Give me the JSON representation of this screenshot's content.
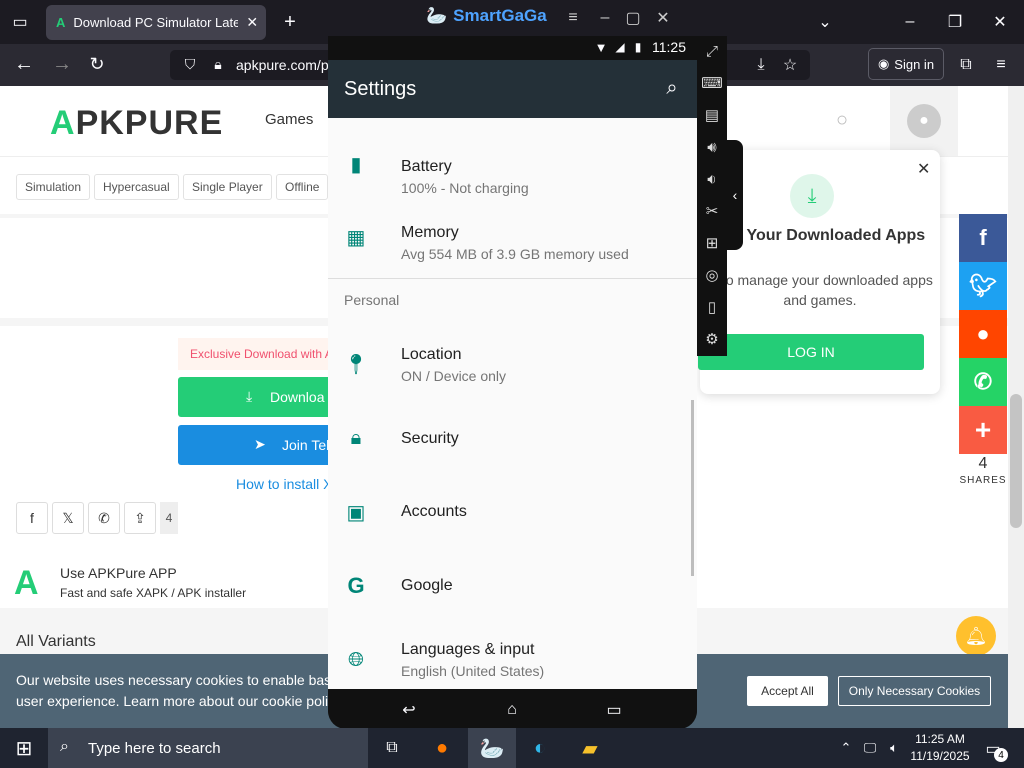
{
  "browser": {
    "tab_title": "Download PC Simulator Latest V",
    "url": "apkpure.com/p",
    "signin": "Sign in"
  },
  "smartgaga": {
    "title": "SmartGaGa"
  },
  "site": {
    "logo_a": "A",
    "logo_rest": "PKPURE",
    "nav_games": "Games",
    "chips": [
      "Simulation",
      "Hypercasual",
      "Single Player",
      "Offline"
    ],
    "exclusive": "Exclusive Download with A",
    "download": "Downloa",
    "join": "Join Tel",
    "howto": "How to install X",
    "share_count": "4",
    "app_title": "Use APKPure APP",
    "app_sub": "Fast and safe XAPK / APK installer",
    "variants": "All Variants",
    "popup": {
      "title": "age Your Downloaded Apps",
      "sub": "in to manage your downloaded apps and games.",
      "login": "LOG IN"
    },
    "shares_num": "4",
    "shares_label": "SHARES",
    "cookie": {
      "text": "Our website uses necessary cookies to enable bas user experience. Learn more about our cookie poli",
      "accept": "Accept All",
      "necessary": "Only Necessary Cookies"
    }
  },
  "android": {
    "time": "11:25",
    "title": "Settings",
    "items": [
      {
        "title": "Battery",
        "sub": "100% - Not charging"
      },
      {
        "title": "Memory",
        "sub": "Avg 554 MB of 3.9 GB memory used"
      },
      {
        "title": "Location",
        "sub": "ON / Device only"
      },
      {
        "title": "Security",
        "sub": ""
      },
      {
        "title": "Accounts",
        "sub": ""
      },
      {
        "title": "Google",
        "sub": ""
      },
      {
        "title": "Languages & input",
        "sub": "English (United States)"
      }
    ],
    "section": "Personal"
  },
  "taskbar": {
    "search": "Type here to search",
    "time": "11:25 AM",
    "date": "11/19/2025",
    "notif": "4"
  }
}
